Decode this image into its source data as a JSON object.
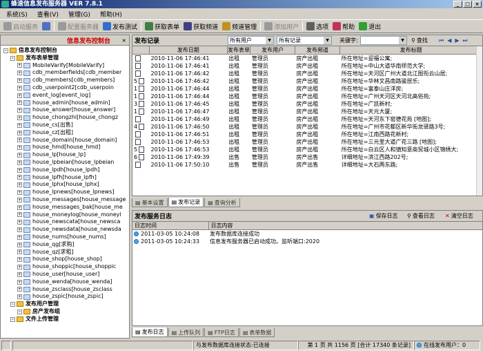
{
  "window": {
    "title": "蜂速信息发布服务器 VER 7.8.1"
  },
  "menu": [
    "系统(S)",
    "查看(V)",
    "管理(G)",
    "帮助(H)"
  ],
  "toolbar": [
    {
      "label": "启动服务",
      "icon": "play-icon",
      "disabled": true,
      "color": "#9a9a9a"
    },
    {
      "label": "",
      "icon": "pause-icon",
      "disabled": false,
      "color": "#5070c0"
    },
    {
      "label": "配置服务器",
      "icon": "settings-icon",
      "disabled": true,
      "color": "#9a9a9a"
    },
    {
      "label": "发布测试",
      "icon": "test-icon",
      "disabled": false,
      "color": "#3070c8"
    },
    {
      "label": "获取表单",
      "icon": "form-icon",
      "disabled": false,
      "color": "#408040"
    },
    {
      "label": "获取频道",
      "icon": "channel-icon",
      "disabled": false,
      "color": "#404080"
    },
    {
      "label": "频道管理",
      "icon": "channel-manage-icon",
      "disabled": false,
      "color": "#c09020"
    },
    {
      "label": "添加用户",
      "icon": "add-user-icon",
      "disabled": true,
      "color": "#9a9a9a"
    },
    {
      "label": "选项",
      "icon": "options-icon",
      "disabled": false,
      "color": "#606060"
    },
    {
      "label": "帮助",
      "icon": "help-icon",
      "disabled": false,
      "color": "#c03060"
    },
    {
      "label": "退出",
      "icon": "exit-icon",
      "disabled": false,
      "color": "#30a030"
    }
  ],
  "left_panel": {
    "title": "信息发布控制台",
    "tree": [
      {
        "label": "信息发布控制台",
        "level": 0,
        "bold": true,
        "type": "root"
      },
      {
        "label": "发布表单管理",
        "level": 1,
        "bold": true,
        "type": "folder"
      },
      {
        "label": "MobileVarify[MobileVarify]",
        "level": 2,
        "type": "table"
      },
      {
        "label": "cdb_memberfields[cdb_member",
        "level": 2,
        "type": "table"
      },
      {
        "label": "cdb_members[cdb_members]",
        "level": 2,
        "type": "table"
      },
      {
        "label": "cdb_userpoint2[cdb_userpoin",
        "level": 2,
        "type": "table"
      },
      {
        "label": "event_log[event_log]",
        "level": 2,
        "type": "table"
      },
      {
        "label": "house_admin[house_admin]",
        "level": 2,
        "type": "table"
      },
      {
        "label": "house_answer[house_answer]",
        "level": 2,
        "type": "table"
      },
      {
        "label": "house_chongzhi[house_chongz",
        "level": 2,
        "type": "table"
      },
      {
        "label": "house_cs[出售]",
        "level": 2,
        "type": "table"
      },
      {
        "label": "house_cz[出租]",
        "level": 2,
        "type": "table"
      },
      {
        "label": "house_domain[house_domain]",
        "level": 2,
        "type": "table"
      },
      {
        "label": "house_hmd[house_hmd]",
        "level": 2,
        "type": "table"
      },
      {
        "label": "house_lp[house_lp]",
        "level": 2,
        "type": "table"
      },
      {
        "label": "house_lpbeian[house_lpbeian",
        "level": 2,
        "type": "table"
      },
      {
        "label": "house_lpdh[house_lpdh]",
        "level": 2,
        "type": "table"
      },
      {
        "label": "house_lpfh[house_lpfh]",
        "level": 2,
        "type": "table"
      },
      {
        "label": "house_lphx[house_lphx]",
        "level": 2,
        "type": "table"
      },
      {
        "label": "house_lpnews[house_lpnews]",
        "level": 2,
        "type": "table"
      },
      {
        "label": "house_messages[house_message",
        "level": 2,
        "type": "table"
      },
      {
        "label": "house_messages_bak[house_me",
        "level": 2,
        "type": "table"
      },
      {
        "label": "house_moneylog[house_moneyl",
        "level": 2,
        "type": "table"
      },
      {
        "label": "house_newscata[house_newsca",
        "level": 2,
        "type": "table"
      },
      {
        "label": "house_newsdata[house_newsda",
        "level": 2,
        "type": "table"
      },
      {
        "label": "house_nums[house_nums]",
        "level": 2,
        "type": "table"
      },
      {
        "label": "house_qg[求购]",
        "level": 2,
        "type": "table"
      },
      {
        "label": "house_qz[求租]",
        "level": 2,
        "type": "table"
      },
      {
        "label": "house_shop[house_shop]",
        "level": 2,
        "type": "table"
      },
      {
        "label": "house_shoppic[house_shoppic",
        "level": 2,
        "type": "table"
      },
      {
        "label": "house_user[house_user]",
        "level": 2,
        "type": "table"
      },
      {
        "label": "house_wenda[house_wenda]",
        "level": 2,
        "type": "table"
      },
      {
        "label": "house_zsclass[house_zsclass",
        "level": 2,
        "type": "table"
      },
      {
        "label": "house_zspic[house_zspic]",
        "level": 2,
        "type": "table"
      },
      {
        "label": "发布用户管理",
        "level": 1,
        "bold": true,
        "type": "folder"
      },
      {
        "label": "房产发布组",
        "level": 2,
        "bold": true,
        "type": "folder"
      },
      {
        "label": "文件上传管理",
        "level": 1,
        "bold": true,
        "type": "folder"
      }
    ]
  },
  "publish_records": {
    "title": "发布记录",
    "user_filter": "所有用户",
    "record_filter": "所有记录",
    "keyword_label": "关键字:",
    "keyword_value": "",
    "search_label": "查找",
    "columns": [
      "",
      "发布日期",
      "发布表单",
      "发布用户",
      "发布频道",
      "发布标题"
    ],
    "rows": [
      {
        "n": "",
        "date": "2010-11-06 17:46:41",
        "form": "出租",
        "user": "管理员",
        "channel": "房产出租",
        "title": "所在地址=迎福公寓;"
      },
      {
        "n": "",
        "date": "2010-11-06 17:46:41",
        "form": "出租",
        "user": "管理员",
        "channel": "房产出租",
        "title": "所在地址=中山大道华南师范大学;"
      },
      {
        "n": "",
        "date": "2010-11-06 17:46:42",
        "form": "出租",
        "user": "管理员",
        "channel": "房产出租",
        "title": "所在地址=天河区广州大道北江图衔云山居;"
      },
      {
        "n": "5",
        "date": "2010-11-06 17:46:42",
        "form": "出租",
        "user": "管理员",
        "channel": "房产出租",
        "title": "所在地址=华林文昌南路骏居乐;"
      },
      {
        "n": "1",
        "date": "2010-11-06 17:46:44",
        "form": "出租",
        "user": "管理员",
        "channel": "房产出租",
        "title": "所在地址=富泰山庄洋房;"
      },
      {
        "n": "1",
        "date": "2010-11-06 17:46:44",
        "form": "出租",
        "user": "管理员",
        "channel": "房产出租",
        "title": "所在地址=广州天河区天河北高俗苑;"
      },
      {
        "n": "3",
        "date": "2010-11-06 17:46:45",
        "form": "出租",
        "user": "管理员",
        "channel": "房产出租",
        "title": "所在地址=广凯新村;"
      },
      {
        "n": "1",
        "date": "2010-11-06 17:46:47",
        "form": "出租",
        "user": "管理员",
        "channel": "房产出租",
        "title": "所在地址=天元大厦;"
      },
      {
        "n": "",
        "date": "2010-11-06 17:46:49",
        "form": "出租",
        "user": "管理员",
        "channel": "房产出租",
        "title": "所在地址=天河东下窑德花苑 [地图];"
      },
      {
        "n": "4",
        "date": "2010-11-06 17:46:50",
        "form": "出租",
        "user": "管理员",
        "channel": "房产出租",
        "title": "所在地址=广州市花都区新华街龙驿路3号;"
      },
      {
        "n": "",
        "date": "2010-11-06 17:46:51",
        "form": "出租",
        "user": "管理员",
        "channel": "房产出租",
        "title": "所在地址=江南西路花新村;"
      },
      {
        "n": "",
        "date": "2010-11-06 17:46:53",
        "form": "出租",
        "user": "管理员",
        "channel": "房产出租",
        "title": "所在地址=三元里大道广花三路 [地图];"
      },
      {
        "n": "5",
        "date": "2010-11-06 17:46:53",
        "form": "出租",
        "user": "管理员",
        "channel": "房产出租",
        "title": "所在地址=白云区人和镇知意商贸城小区锦绣大;"
      },
      {
        "n": "6",
        "date": "2010-11-06 17:49:39",
        "form": "出售",
        "user": "管理员",
        "channel": "房产出售",
        "title": "详细地址=滨江西路202号;"
      },
      {
        "n": "",
        "date": "2010-11-06 17:50:10",
        "form": "出售",
        "user": "管理员",
        "channel": "房产出售",
        "title": "详细地址=大石两东路;"
      }
    ]
  },
  "top_tabs": [
    "基本设置",
    "发布记录",
    "查询分析"
  ],
  "service_log": {
    "title": "发布服务日志",
    "save_label": "保存日志",
    "view_label": "查看日志",
    "clear_label": "清空日志",
    "columns": [
      "日志时间",
      "日志内容"
    ],
    "rows": [
      {
        "time": "2011-03-05 10:24:08",
        "content": "发布数据库连接成功"
      },
      {
        "time": "2011-03-05 10:24:33",
        "content": "信息发布服务器已启动成功。监听端口:2020"
      }
    ]
  },
  "bottom_tabs": [
    "发布日志",
    "上传队列",
    "FTP日志",
    "表单数据"
  ],
  "status": {
    "db": "与发布数据库连接状态:已连接",
    "pages": "第 1 页 共 1156 页 [合计 17340 条记录]",
    "online": "在线发布用户：0"
  }
}
